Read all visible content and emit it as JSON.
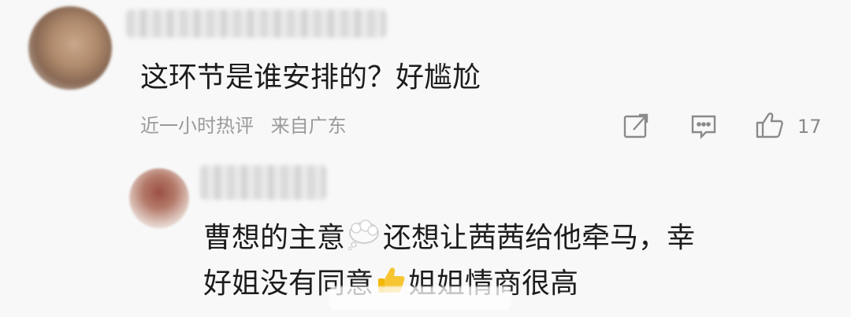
{
  "comment": {
    "text": "这环节是谁安排的？好尴尬",
    "time": "近一小时热评",
    "location": "来自广东",
    "like_count": "17"
  },
  "reply": {
    "line1_part1": "曹想的主意",
    "line1_part2": "还想让茜茜给他牵马，幸",
    "line2_part1": "好姐没有同意",
    "line2_part2": "姐姐情商很高",
    "emojis": [
      "thought-bubble-icon",
      "thumbs-up-icon"
    ]
  },
  "icons": {
    "share": "share-icon",
    "comment": "comment-icon",
    "like": "thumbs-up-icon"
  }
}
